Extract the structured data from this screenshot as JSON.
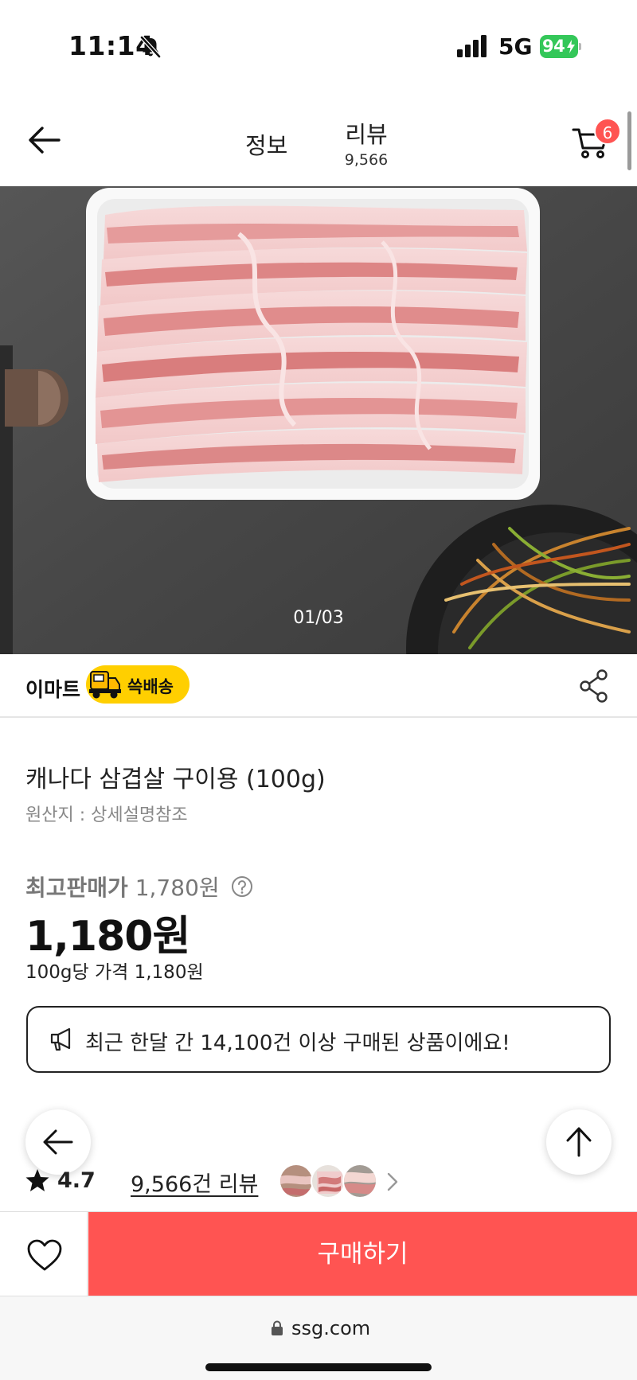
{
  "status_bar": {
    "time": "11:14",
    "network": "5G",
    "battery": "94",
    "icons": [
      "bell-slash-icon",
      "signal-icon",
      "battery-charging-icon"
    ]
  },
  "header": {
    "tab_info": "정보",
    "tab_review": "리뷰",
    "review_count": "9,566",
    "cart_badge": "6"
  },
  "gallery": {
    "counter": "01/03"
  },
  "seller": {
    "name": "이마트",
    "delivery_label": "쓱배송"
  },
  "product": {
    "title": "캐나다 삼겹살 구이용 (100g)",
    "origin": "원산지 : 상세설명참조"
  },
  "price": {
    "label": "최고판매가",
    "original": "1,780원",
    "current": "1,180원",
    "unit_price": "100g당 가격 1,180원"
  },
  "promo": {
    "text": "최근 한달 간 14,100건 이상 구매된 상품이에요!"
  },
  "rating": {
    "value": "4.7",
    "review_link": "9,566건 리뷰"
  },
  "actions": {
    "buy_label": "구매하기"
  },
  "browser": {
    "url": "ssg.com"
  },
  "colors": {
    "accent": "#ff5452",
    "delivery_badge": "#ffcf00",
    "battery": "#34c759"
  }
}
